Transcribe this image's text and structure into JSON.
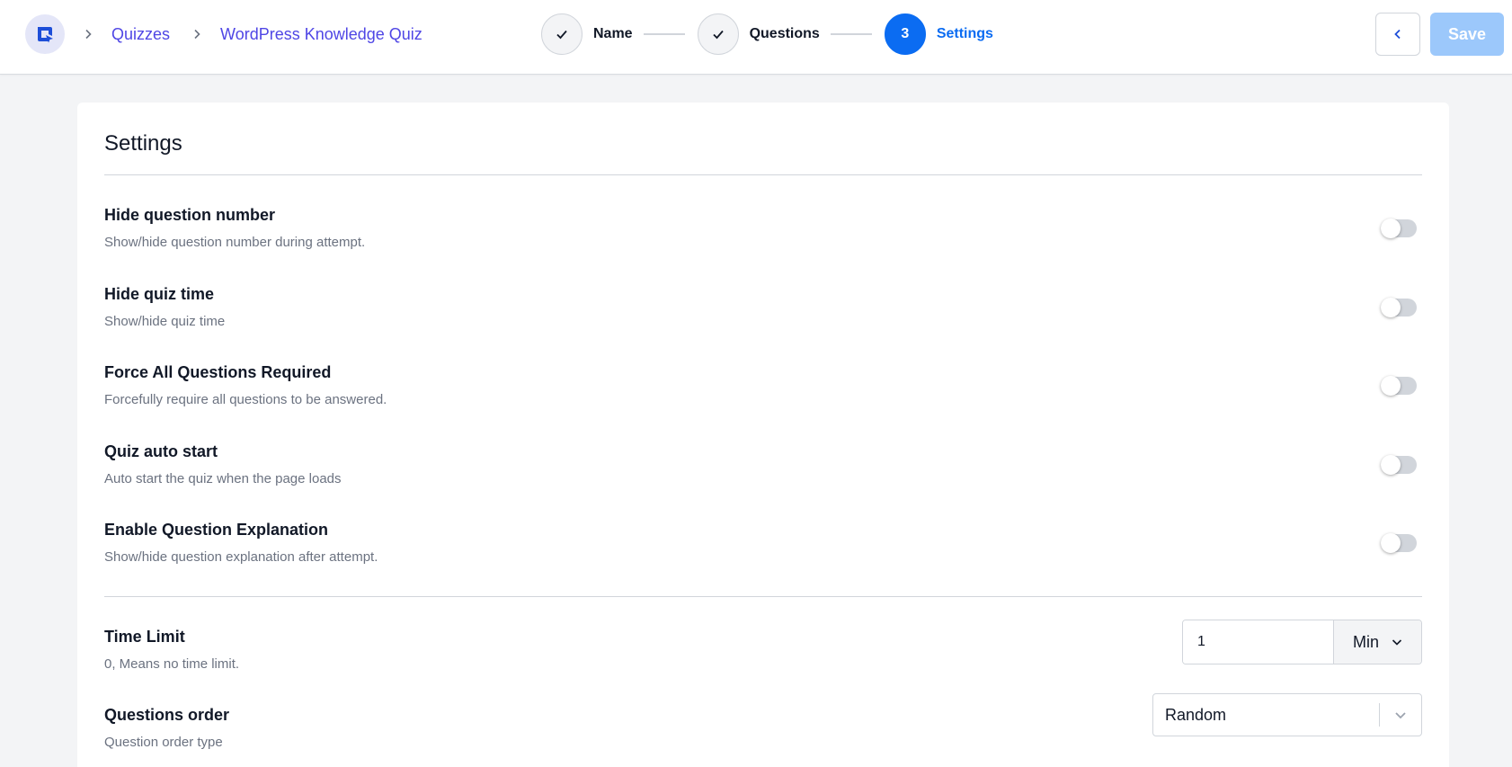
{
  "header": {
    "breadcrumb": [
      "Quizzes",
      "WordPress Knowledge Quiz"
    ],
    "steps": [
      {
        "label": "Name",
        "state": "done"
      },
      {
        "label": "Questions",
        "state": "done"
      },
      {
        "label": "Settings",
        "state": "active",
        "number": "3"
      }
    ],
    "save_label": "Save"
  },
  "settings": {
    "title": "Settings",
    "toggles": [
      {
        "title": "Hide question number",
        "description": "Show/hide question number during attempt.",
        "enabled": false
      },
      {
        "title": "Hide quiz time",
        "description": "Show/hide quiz time",
        "enabled": false
      },
      {
        "title": "Force All Questions Required",
        "description": "Forcefully require all questions to be answered.",
        "enabled": false
      },
      {
        "title": "Quiz auto start",
        "description": "Auto start the quiz when the page loads",
        "enabled": false
      },
      {
        "title": "Enable Question Explanation",
        "description": "Show/hide question explanation after attempt.",
        "enabled": false
      }
    ],
    "time_limit": {
      "title": "Time Limit",
      "description": "0, Means no time limit.",
      "value": "1",
      "unit": "Min"
    },
    "questions_order": {
      "title": "Questions order",
      "description": "Question order type",
      "value": "Random"
    }
  },
  "colors": {
    "accent": "#0b6cf2",
    "link": "#4f46e5",
    "save_disabled": "#9cc8fb",
    "toggle_off": "#d1d5db"
  }
}
